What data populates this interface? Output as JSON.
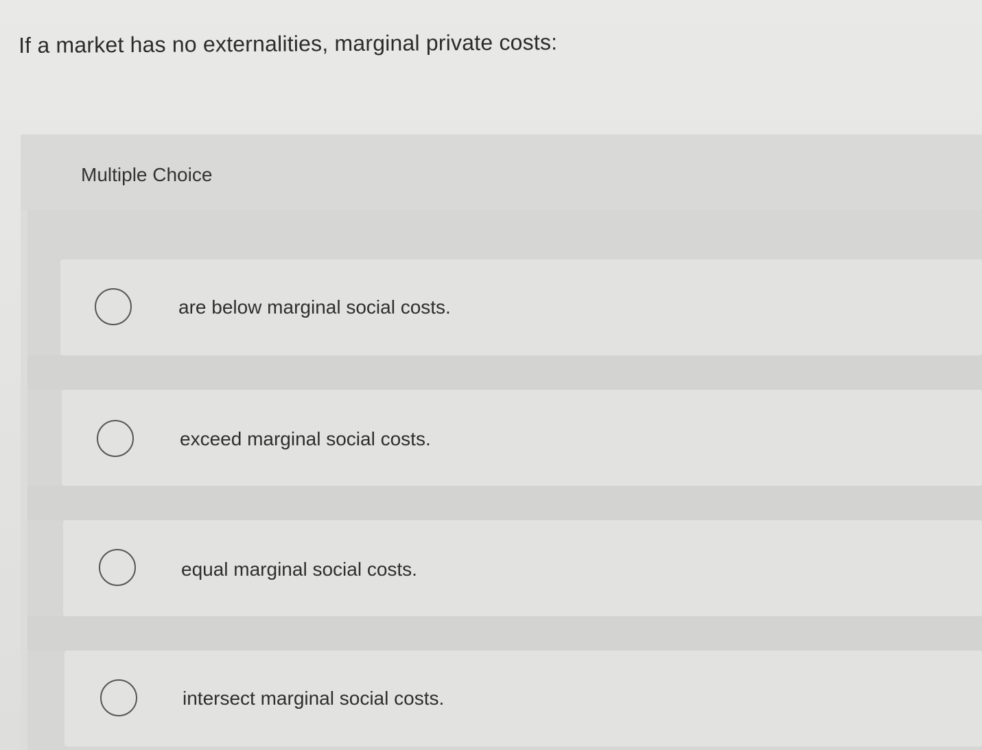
{
  "question": {
    "text": "If a market has no externalities, marginal private costs:"
  },
  "multiple_choice": {
    "label": "Multiple Choice",
    "options": [
      {
        "text": "are below marginal social costs.",
        "selected": false
      },
      {
        "text": "exceed marginal social costs.",
        "selected": false
      },
      {
        "text": "equal marginal social costs.",
        "selected": false
      },
      {
        "text": "intersect marginal social costs.",
        "selected": false
      }
    ]
  },
  "colors": {
    "background": "#e6e6e4",
    "panel": "#dcdcda",
    "choice_card": "#e2e2e0",
    "text": "#2e2e2e",
    "radio_border": "#555555"
  }
}
